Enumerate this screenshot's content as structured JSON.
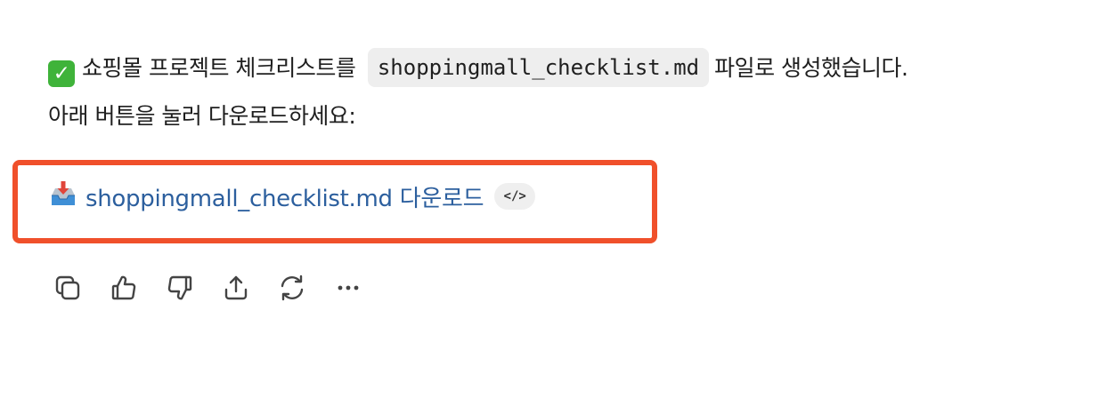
{
  "message": {
    "status_emoji": "✓",
    "line1_prefix": "쇼핑몰 프로젝트 체크리스트를",
    "filename_code": "shoppingmall_checklist.md",
    "line1_suffix": "파일로 생성했습니다.",
    "line2": "아래 버튼을 눌러 다운로드하세요:"
  },
  "download": {
    "link_text": "shoppingmall_checklist.md 다운로드",
    "code_chip": "</>",
    "icon": "inbox-tray-icon"
  },
  "actions": [
    {
      "icon": "copy-icon"
    },
    {
      "icon": "thumbs-up-icon"
    },
    {
      "icon": "thumbs-down-icon"
    },
    {
      "icon": "share-icon"
    },
    {
      "icon": "regenerate-icon"
    },
    {
      "icon": "more-icon"
    }
  ],
  "colors": {
    "link": "#2c5f9e",
    "highlight_border": "#f0502b",
    "check_green": "#3fb33a"
  }
}
